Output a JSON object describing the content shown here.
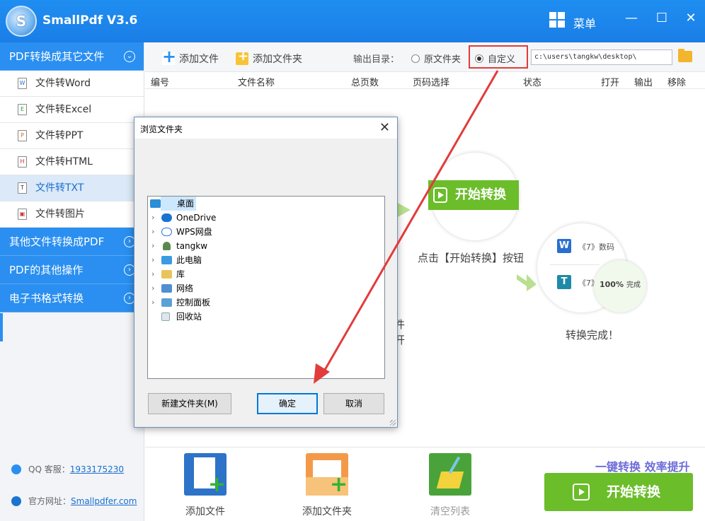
{
  "app": {
    "title": "SmallPdf V3.6",
    "logo_letter": "S",
    "menu_label": "菜单"
  },
  "window_controls": {
    "minimize": "—",
    "maximize": "☐",
    "close": "✕"
  },
  "sidebar": {
    "cat1": "PDF转换成其它文件",
    "items": [
      {
        "label": "文件转Word",
        "icon": "W"
      },
      {
        "label": "文件转Excel",
        "icon": "E"
      },
      {
        "label": "文件转PPT",
        "icon": "P"
      },
      {
        "label": "文件转HTML",
        "icon": "H"
      },
      {
        "label": "文件转TXT",
        "icon": "T",
        "active": true
      },
      {
        "label": "文件转图片",
        "icon": "▣"
      }
    ],
    "cat2": "其他文件转换成PDF",
    "cat3": "PDF的其他操作",
    "cat4": "电子书格式转换",
    "qq_label": "QQ 客服：",
    "qq_value": "1933175230",
    "site_label": "官方网址：",
    "site_value": "Smallpdfer.com"
  },
  "toolbar": {
    "add_file": "添加文件",
    "add_folder": "添加文件夹",
    "output_label": "输出目录：",
    "radio_original": "原文件夹",
    "radio_custom": "自定义",
    "path_value": "c:\\users\\tangkw\\desktop\\"
  },
  "table": {
    "headers": [
      "编号",
      "文件名称",
      "总页数",
      "页码选择",
      "状态",
      "打开",
      "输出",
      "移除"
    ]
  },
  "illustration": {
    "start_pill": "开始转换",
    "caption_click": "点击【开始转换】按钮",
    "doc1": "《7》数码",
    "doc2": "《7》",
    "progress": "100%",
    "progress_label": "完成",
    "caption_done": "转换完成！",
    "partial1": "件",
    "partial2": "开"
  },
  "dialog": {
    "title": "浏览文件夹",
    "close": "✕",
    "tree": [
      {
        "label": "桌面",
        "selected": true
      },
      {
        "label": "OneDrive"
      },
      {
        "label": "WPS网盘"
      },
      {
        "label": "tangkw"
      },
      {
        "label": "此电脑"
      },
      {
        "label": "库"
      },
      {
        "label": "网络"
      },
      {
        "label": "控制面板"
      },
      {
        "label": "回收站"
      }
    ],
    "new_folder": "新建文件夹(M)",
    "ok": "确定",
    "cancel": "取消"
  },
  "bottom": {
    "add_file": "添加文件",
    "add_folder": "添加文件夹",
    "clear_list": "清空列表",
    "slogan": "一键转换  效率提升",
    "start": "开始转换"
  },
  "colors": {
    "brand_blue": "#2a8ff0",
    "green": "#6bbd2a",
    "highlight_red": "#e23b3b"
  }
}
